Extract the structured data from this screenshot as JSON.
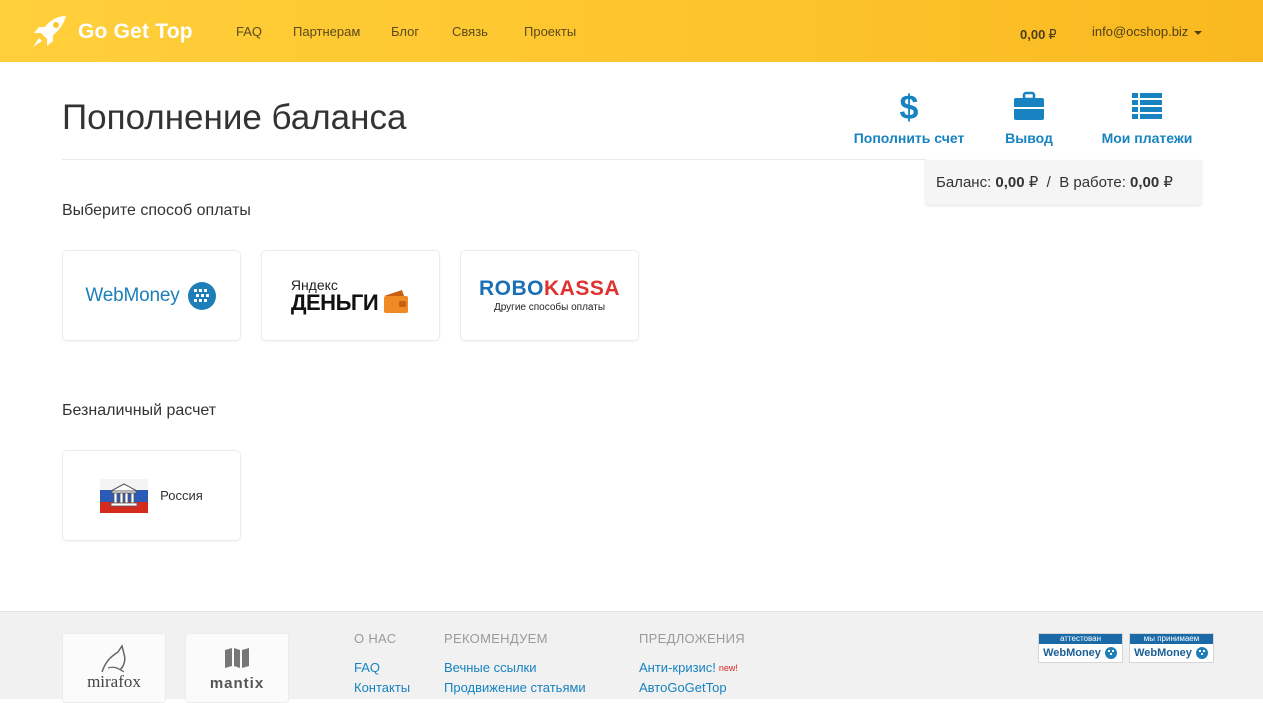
{
  "header": {
    "logo_text": "Go Get Top",
    "nav": [
      "FAQ",
      "Партнерам",
      "Блог",
      "Связь",
      "Проекты"
    ],
    "balance_value": "0,00",
    "balance_currency": "₽",
    "user_email": "info@ocshop.biz"
  },
  "page": {
    "title": "Пополнение баланса"
  },
  "actions": {
    "deposit": "Пополнить счет",
    "withdraw": "Вывод",
    "payments": "Мои платежи"
  },
  "balance_box": {
    "balance_label": "Баланс:",
    "balance_value": "0,00",
    "currency": "₽",
    "separator": "/",
    "in_work_label": "В работе:",
    "in_work_value": "0,00"
  },
  "payment_section": {
    "title": "Выберите способ оплаты",
    "methods": {
      "webmoney": "WebMoney",
      "yandex_small": "Яндекс",
      "yandex_big": "ДЕНЬГИ",
      "robokassa_robo": "ROBO",
      "robokassa_kassa": "KASSA",
      "robokassa_sub": "Другие способы оплаты"
    }
  },
  "cashless_section": {
    "title": "Безналичный расчет",
    "russia_label": "Россия"
  },
  "footer": {
    "partners": [
      "mirafox",
      "mantix"
    ],
    "about": {
      "heading": "О НАС",
      "links": [
        "FAQ",
        "Контакты"
      ]
    },
    "recommend": {
      "heading": "РЕКОМЕНДУЕМ",
      "links": [
        "Вечные ссылки",
        "Продвижение статьями"
      ]
    },
    "offers": {
      "heading": "ПРЕДЛОЖЕНИЯ",
      "links": [
        "Анти-кризис!",
        "АвтоGoGetTop"
      ],
      "new_tag": "new!"
    },
    "badges": [
      {
        "top": "аттестован",
        "bottom": "WebMoney"
      },
      {
        "top": "мы принимаем",
        "bottom": "WebMoney"
      }
    ]
  },
  "colors": {
    "header_yellow": "#fdc42c",
    "link_blue": "#1783c1",
    "webmoney_blue": "#1e7fb8",
    "yandex_orange": "#f08a24",
    "robokassa_blue": "#1a6fb5",
    "robokassa_red": "#e0312f"
  }
}
